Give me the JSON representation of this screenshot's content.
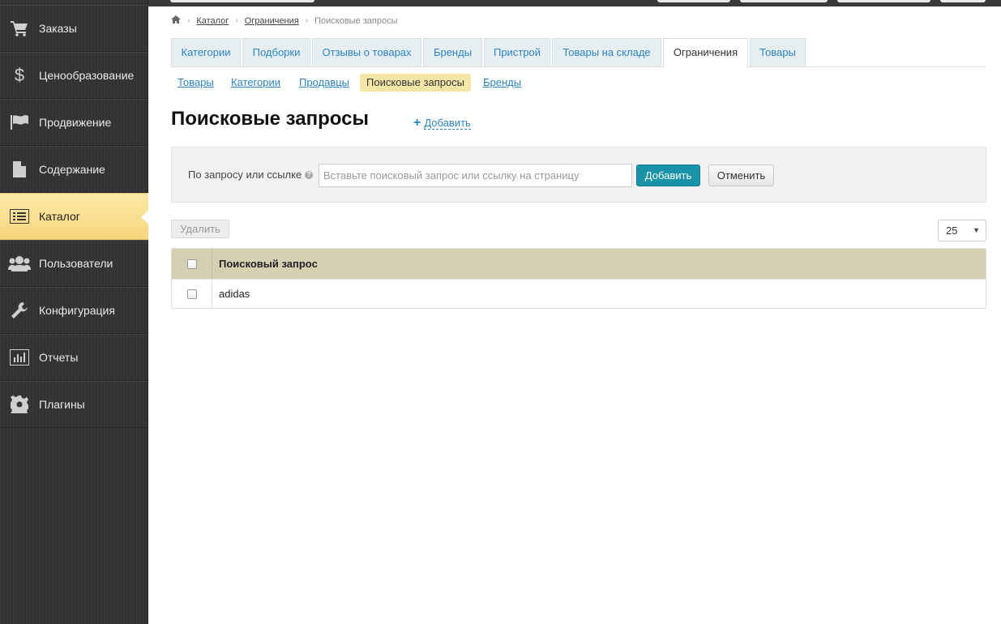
{
  "sidebar": {
    "items": [
      {
        "label": "Заказы",
        "icon": "cart-icon"
      },
      {
        "label": "Ценообразование",
        "icon": "dollar-icon"
      },
      {
        "label": "Продвижение",
        "icon": "flag-icon"
      },
      {
        "label": "Содержание",
        "icon": "document-icon"
      },
      {
        "label": "Каталог",
        "icon": "list-icon",
        "active": true
      },
      {
        "label": "Пользователи",
        "icon": "users-icon"
      },
      {
        "label": "Конфигурация",
        "icon": "wrench-icon"
      },
      {
        "label": "Отчеты",
        "icon": "chart-icon"
      },
      {
        "label": "Плагины",
        "icon": "gear-icon"
      }
    ]
  },
  "breadcrumb": {
    "home_icon": "home-icon",
    "items": [
      "Каталог",
      "Ограничения"
    ],
    "current": "Поисковые запросы"
  },
  "tabs": [
    {
      "label": "Категории"
    },
    {
      "label": "Подборки"
    },
    {
      "label": "Отзывы о товарах"
    },
    {
      "label": "Бренды"
    },
    {
      "label": "Пристрой"
    },
    {
      "label": "Товары на складе"
    },
    {
      "label": "Ограничения",
      "active": true
    },
    {
      "label": "Товары"
    }
  ],
  "subtabs": [
    {
      "label": "Товары"
    },
    {
      "label": "Категории"
    },
    {
      "label": "Продавцы"
    },
    {
      "label": "Поисковые запросы",
      "active": true
    },
    {
      "label": "Бренды"
    }
  ],
  "page": {
    "title": "Поисковые запросы",
    "add_link": "Добавить"
  },
  "filter": {
    "label": "По запросу или ссылке",
    "placeholder": "Вставьте поисковый запрос или ссылку на страницу",
    "value": "",
    "submit_label": "Добавить",
    "cancel_label": "Отменить"
  },
  "toolbar": {
    "delete_label": "Удалить",
    "page_size": "25"
  },
  "table": {
    "header": "Поисковый запрос",
    "rows": [
      "adidas"
    ]
  },
  "colors": {
    "accent": "#2a84c4",
    "primary_button": "#1a93a8",
    "active_nav": "#f6d67c",
    "table_header": "#d6d0b3",
    "sidebar": "#333333"
  }
}
